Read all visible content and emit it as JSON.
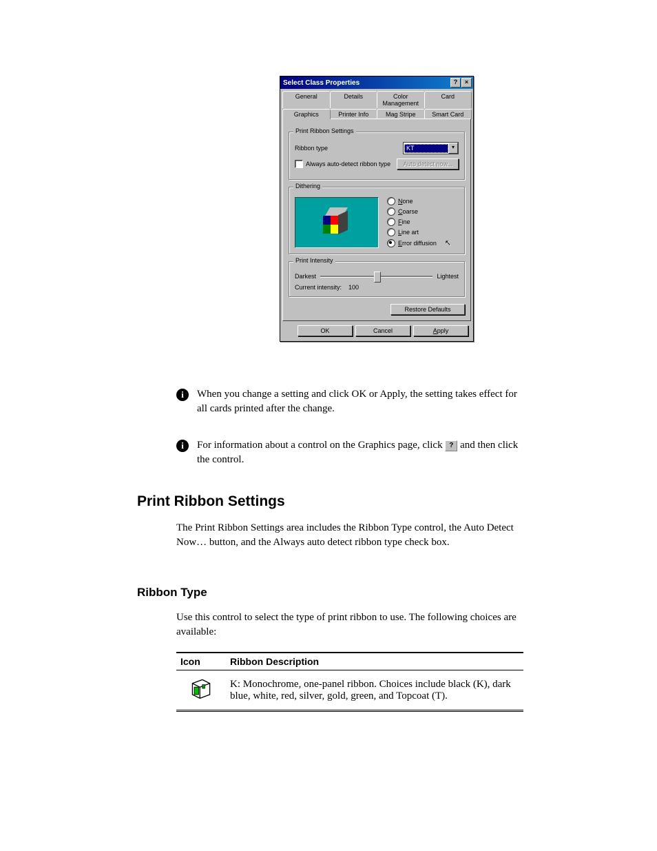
{
  "dialog": {
    "title": "Select Class Properties",
    "titlebar_help": "?",
    "titlebar_close": "×",
    "tabs_row1": [
      "General",
      "Details",
      "Color Management",
      "Card"
    ],
    "tabs_row2": [
      "Graphics",
      "Printer Info",
      "Mag Stripe",
      "Smart Card"
    ],
    "group_ribbon": {
      "title": "Print Ribbon Settings",
      "ribbon_type_label": "Ribbon type",
      "ribbon_type_value": "KT",
      "always_auto_label": "Always auto-detect ribbon type",
      "auto_detect_button": "Auto detect now..."
    },
    "group_dither": {
      "title": "Dithering",
      "options": {
        "none": "None",
        "coarse": "Coarse",
        "fine": "Fine",
        "lineart": "Line art",
        "error": "Error diffusion"
      }
    },
    "group_intensity": {
      "title": "Print Intensity",
      "darkest": "Darkest",
      "lightest": "Lightest",
      "current_label": "Current intensity:",
      "current_value": "100"
    },
    "restore_defaults": "Restore Defaults",
    "ok": "OK",
    "cancel": "Cancel",
    "apply": "Apply"
  },
  "page": {
    "note1": "When you change a setting and click OK or Apply, the setting takes effect for all cards printed after the change.",
    "note2_a": "For information about a control on the Graphics page, click",
    "note2_b": "and then click the control.",
    "note2_help": "?",
    "section_title": "Print Ribbon Settings",
    "section_desc": "The Print Ribbon Settings area includes the Ribbon Type control, the Auto Detect Now… button, and the Always auto detect ribbon type check box.",
    "ribbon_heading": "Ribbon Type",
    "ribbon_text": "Use this control to select the type of print ribbon to use. The following choices are available:",
    "table": {
      "col1": "Icon",
      "col2": "Ribbon Description",
      "row1": "K: Monochrome, one-panel ribbon. Choices include black (K), dark blue, white, red, silver, gold, green, and Topcoat (T)."
    }
  }
}
